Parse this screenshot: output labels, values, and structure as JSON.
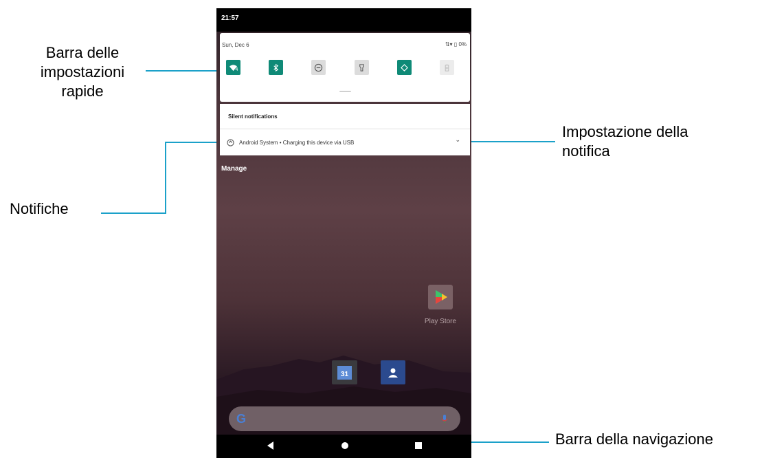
{
  "callouts": {
    "quick_settings_line1": "Barra delle",
    "quick_settings_line2": "impostazioni",
    "quick_settings_line3": "rapide",
    "notifications": "Notifiche",
    "notification_settings_line1": "Impostazione della",
    "notification_settings_line2": "notifica",
    "navigation_bar": "Barra della navigazione"
  },
  "phone": {
    "status_time": "21:57",
    "quick_settings": {
      "date": "Sun, Dec 6",
      "status_right": "0%",
      "tiles": [
        {
          "icon": "wifi-icon",
          "state": "on",
          "badge": "4"
        },
        {
          "icon": "bluetooth-icon",
          "state": "on"
        },
        {
          "icon": "do-not-disturb-icon",
          "state": "off"
        },
        {
          "icon": "flashlight-icon",
          "state": "off"
        },
        {
          "icon": "auto-rotate-icon",
          "state": "on"
        },
        {
          "icon": "battery-saver-icon",
          "state": "disabled"
        }
      ]
    },
    "notifications": {
      "header": "Silent notifications",
      "item": "Android System • Charging this device via USB",
      "expand_icon": "chevron-down-icon"
    },
    "manage_label": "Manage",
    "home": {
      "play_store_label": "Play Store",
      "calendar_day": "31",
      "search_logo": "G"
    }
  },
  "colors": {
    "accent_tile": "#0f8a77",
    "callout_line": "#1ba1c9"
  }
}
